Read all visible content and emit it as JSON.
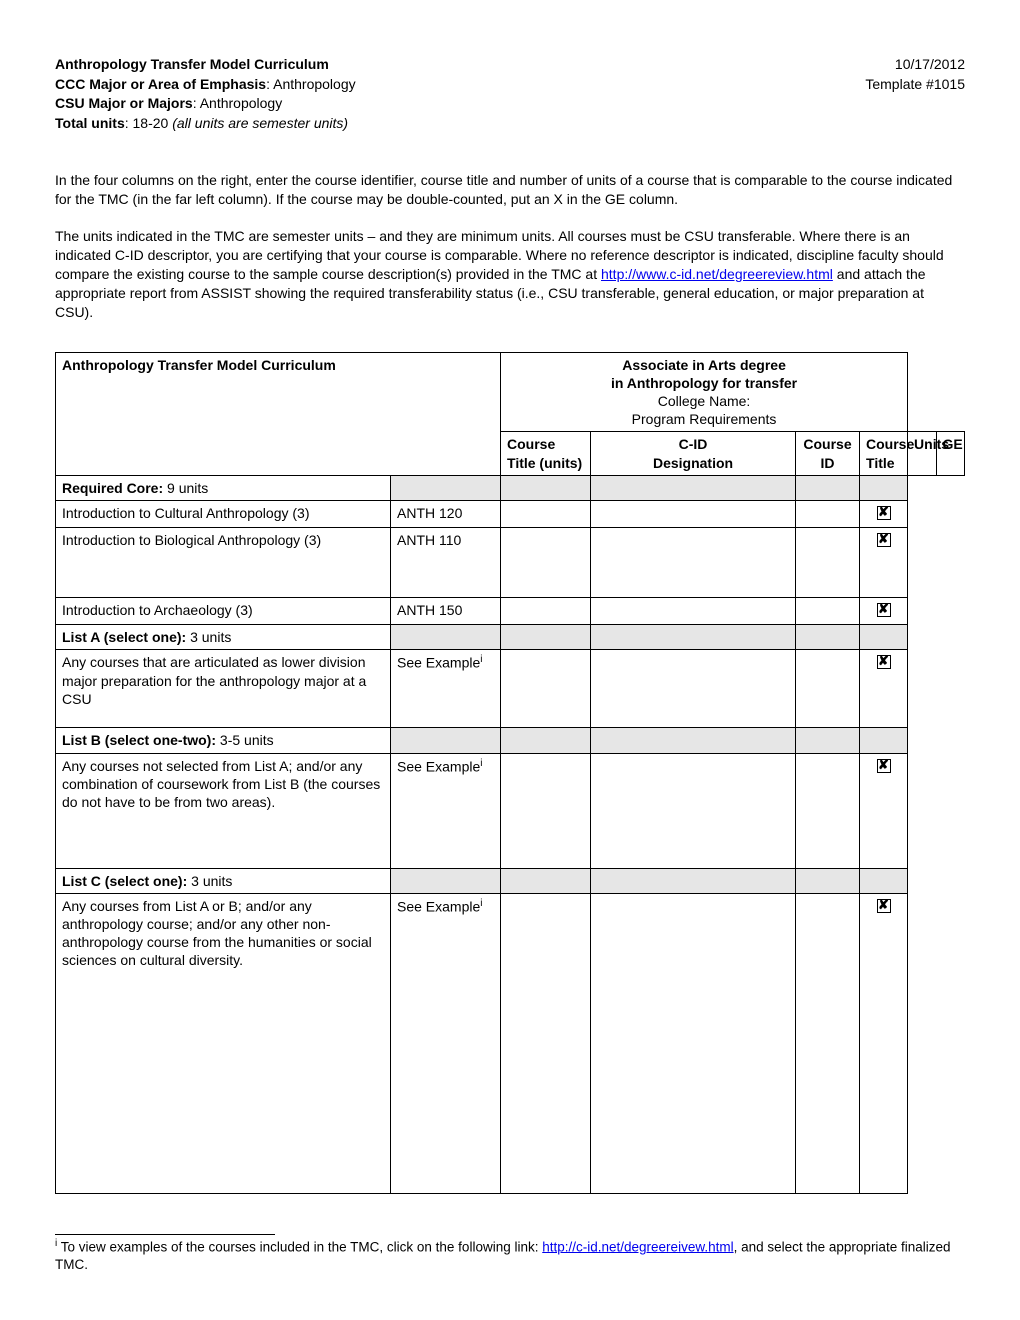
{
  "header": {
    "title": "Anthropology Transfer Model Curriculum",
    "line2_label": "CCC Major or Area of Emphasis",
    "line2_value": ": Anthropology",
    "line3_label": "CSU Major or Majors",
    "line3_value": ": Anthropology",
    "line4_label": "Total units",
    "line4_value": ": 18-20 ",
    "line4_italic": "(all units are semester units)",
    "date": "10/17/2012",
    "template": "Template #1015"
  },
  "intro": {
    "p1": "In the four columns on the right, enter the course identifier, course title and number of units of a course that is comparable\nto the course indicated for the TMC (in the far left column). If the course may be double-counted, put an X in the GE\ncolumn.",
    "p2a": "The units indicated in the TMC are semester units – and they are minimum units. All courses must be CSU transferable.\nWhere there is an indicated C-ID descriptor, you are certifying that your course is comparable.  Where no reference\ndescriptor is indicated, discipline faculty should compare the existing course to the sample course description(s) provided\nin the TMC at ",
    "p2_link": "http://www.c-id.net/degreereview.html",
    "p2b": " and attach the appropriate report from ASSIST showing the required\ntransferability status (i.e., CSU transferable, general education, or major preparation at CSU)."
  },
  "table": {
    "left_header": "Anthropology Transfer Model Curriculum",
    "right_header_bold1": "Associate in Arts degree",
    "right_header_bold2": "in Anthropology for transfer",
    "right_header_line3": "College Name:",
    "right_header_line4": "Program Requirements",
    "col": {
      "course_title_units": "Course Title (units)",
      "cid": "C-ID\nDesignation",
      "course_id": "Course ID",
      "course_title": "Course Title",
      "units": "Units",
      "ge": "GE"
    },
    "rows": {
      "core_header_a": "Required Core:",
      "core_header_b": " 9 units",
      "r1_title": "Introduction to Cultural Anthropology (3)",
      "r1_cid": "ANTH 120",
      "r2_title": "Introduction to Biological Anthropology (3)",
      "r2_cid": "ANTH 110",
      "r3_title": "Introduction to Archaeology (3)",
      "r3_cid": "ANTH 150",
      "listA_header_a": "List A (select one):",
      "listA_header_b": " 3 units",
      "listA_title": "Any courses that are articulated as lower division major preparation for the anthropology major at a CSU",
      "listA_cid": "See Example",
      "listB_header_a": "List B (select one-two):",
      "listB_header_b": " 3-5 units",
      "listB_title": "Any courses not selected from List A; and/or any combination of coursework from List B (the courses do not have to be from two areas).",
      "listB_cid": "See Example",
      "listC_header_a": "List C (select one):",
      "listC_header_b": " 3 units",
      "listC_title": "Any courses from List A or B; and/or any anthropology course; and/or any other non-anthropology course from the humanities or social sciences on cultural diversity.",
      "listC_cid": "See Example",
      "sup": "i"
    }
  },
  "footnote": {
    "sup": "i",
    "text_a": " To view examples of the courses included in the TMC, click on the following link:  ",
    "link": "http://c-id.net/degreereivew.html",
    "text_b": ", and select the\nappropriate finalized TMC."
  }
}
